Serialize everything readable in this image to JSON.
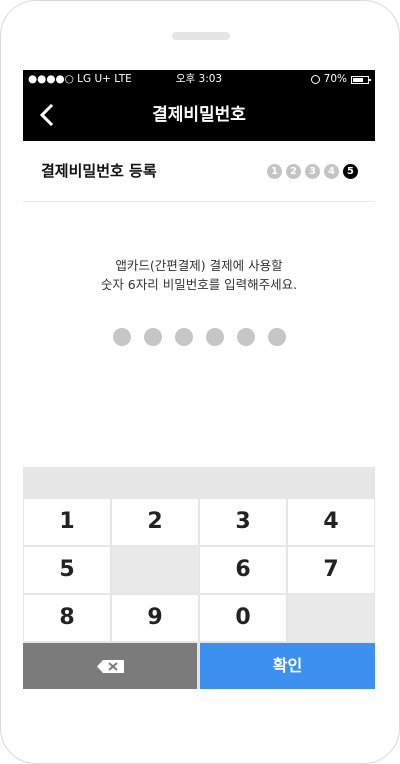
{
  "status_bar": {
    "carrier": "●●●●○ LG U+   LTE",
    "time": "오후 3:03",
    "battery_percent_text": "70%",
    "battery_level": 0.7
  },
  "nav": {
    "title": "결제비밀번호",
    "back_icon": "chevron-left-icon"
  },
  "step_header": {
    "title": "결제비밀번호 등록",
    "steps": [
      "1",
      "2",
      "3",
      "4",
      "5"
    ],
    "active_step": 5
  },
  "instructions": {
    "line1": "앱카드(간편결제) 결제에 사용할",
    "line2": "숫자 6자리 비밀번호를 입력해주세요."
  },
  "pin": {
    "length": 6,
    "entered": 0
  },
  "keypad": {
    "rows": [
      [
        "1",
        "2",
        "3",
        "4"
      ],
      [
        "5",
        "",
        "6",
        "7"
      ],
      [
        "8",
        "9",
        "0",
        ""
      ]
    ],
    "delete_icon": "backspace-icon",
    "confirm_label": "확인"
  },
  "colors": {
    "confirm": "#3d8ff0",
    "delete": "#7b7b7b",
    "step_inactive": "#c4c4c4",
    "step_active": "#000000",
    "pin_dot": "#c6c6c6"
  }
}
